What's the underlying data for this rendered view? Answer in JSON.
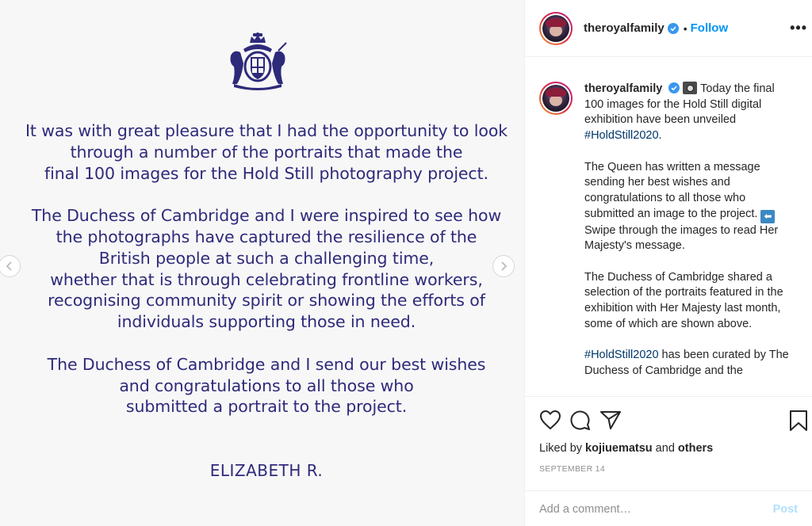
{
  "media": {
    "letter": [
      [
        "It was with great pleasure that I had the opportunity to look",
        "through a number of the portraits that made the",
        "final 100 images for the Hold Still photography project."
      ],
      [
        "The Duchess of Cambridge and I were inspired to see how",
        "the photographs have captured the resilience of the",
        "British people at such a challenging time,",
        "whether that is through celebrating frontline workers,",
        "recognising community spirit or showing the efforts of",
        "individuals supporting those in need."
      ],
      [
        "The Duchess of Cambridge and I send our best wishes",
        "and congratulations to all those who",
        "submitted a portrait to the project."
      ]
    ],
    "signature": "ELIZABETH R.",
    "crest_icon": "royal-coat-of-arms-icon",
    "prev_icon": "chevron-left-icon",
    "next_icon": "chevron-right-icon"
  },
  "header": {
    "username": "theroyalfamily",
    "dot": "•",
    "follow_label": "Follow",
    "more_label": "•••"
  },
  "caption": {
    "username": "theroyalfamily",
    "p1": " Today the final 100 images for the Hold Still digital exhibition have been unveiled ",
    "hashtag1": "#HoldStill2020",
    "p1_end": ".",
    "p2": "The Queen has written a message sending her best wishes and congratulations to all those who submitted an image to the project. ",
    "p2b": "Swipe through the images to read Her Majesty's message.",
    "arrow_glyph": "⬅",
    "p3": "The Duchess of Cambridge shared a selection of the portraits featured in the exhibition with Her Majesty last month, some of which are shown above.",
    "hashtag2": "#HoldStill2020",
    "p4": " has been curated by The Duchess of Cambridge and the"
  },
  "actions": {
    "liked_prefix": "Liked by ",
    "liked_user": "kojiuematsu",
    "liked_and": " and ",
    "liked_others": "others",
    "date": "September 14"
  },
  "comment": {
    "placeholder": "Add a comment…",
    "post_label": "Post"
  },
  "colors": {
    "letter_ink": "#2e2a7a",
    "follow_blue": "#0095f6",
    "hashtag": "#00376b",
    "post_disabled": "#b2dffc"
  }
}
